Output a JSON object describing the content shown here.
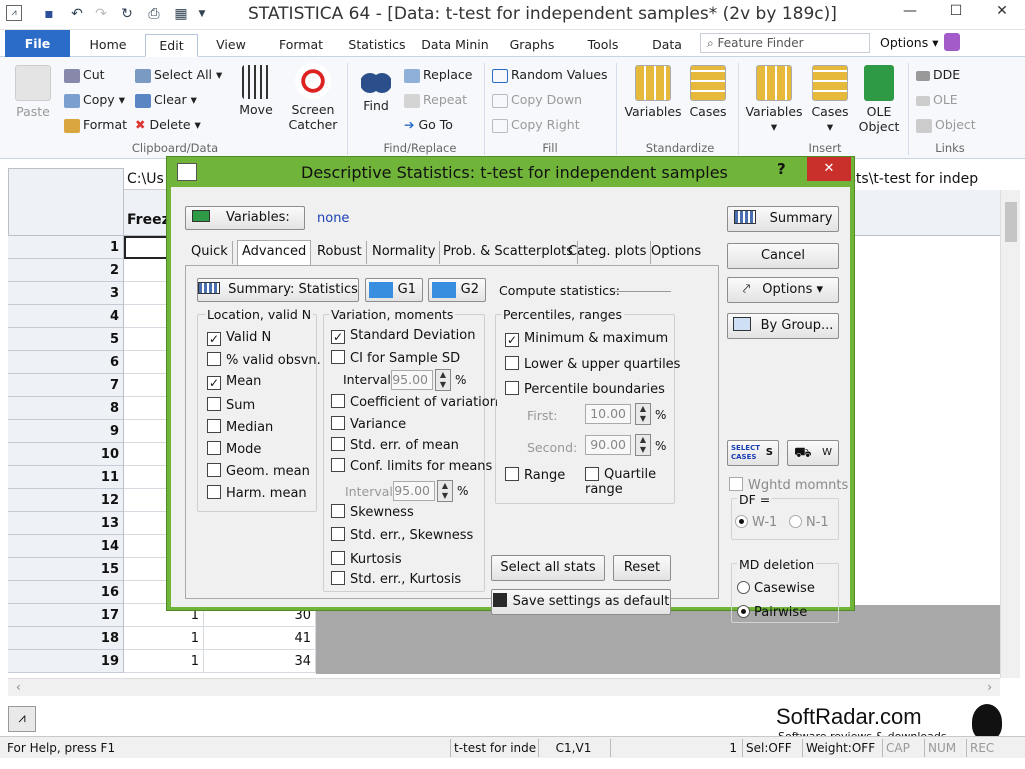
{
  "window": {
    "title": "STATISTICA 64 - [Data: t-test for independent samples* (2v by 189c)]"
  },
  "ribbon_tabs": [
    "File",
    "Home",
    "Edit",
    "View",
    "Format",
    "Statistics",
    "Data Minin",
    "Graphs",
    "Tools",
    "Data"
  ],
  "feature_finder": "Feature Finder",
  "options_menu": "Options",
  "ribbon": {
    "clipboard": {
      "paste": "Paste",
      "cut": "Cut",
      "copy": "Copy",
      "format": "Format",
      "select_all": "Select All",
      "clear": "Clear",
      "delete": "Delete",
      "move": "Move",
      "screen_catcher": "Screen Catcher",
      "group": "Clipboard/Data"
    },
    "find": {
      "find": "Find",
      "replace": "Replace",
      "repeat": "Repeat",
      "goto": "Go To",
      "group": "Find/Replace"
    },
    "fill": {
      "random": "Random Values",
      "copy_down": "Copy Down",
      "copy_right": "Copy Right",
      "group": "Fill"
    },
    "standardize": {
      "variables": "Variables",
      "cases": "Cases",
      "group": "Standardize"
    },
    "insert": {
      "variables": "Variables",
      "cases": "Cases",
      "ole": "OLE Object",
      "group": "Insert"
    },
    "links": {
      "dde": "DDE",
      "ole": "OLE",
      "object": "Object",
      "group": "Links"
    }
  },
  "sheet": {
    "path_cell": "C:\\Us",
    "path_right": "ests\\t-test for indep",
    "col_header": "Freez",
    "rows": [
      "1",
      "2",
      "3",
      "4",
      "5",
      "6",
      "7",
      "8",
      "9",
      "10",
      "11",
      "12",
      "13",
      "14",
      "15",
      "16",
      "17",
      "18",
      "19"
    ],
    "visible_values": [
      {
        "row": "17",
        "a": "1",
        "b": "30"
      },
      {
        "row": "18",
        "a": "1",
        "b": "41"
      },
      {
        "row": "19",
        "a": "1",
        "b": "34"
      }
    ]
  },
  "dialog": {
    "title": "Descriptive Statistics: t-test for independent samples",
    "help": "?",
    "close": "✕",
    "variables_btn": "Variables:",
    "variables_val": "none",
    "tabs": [
      "Quick",
      "Advanced",
      "Robust",
      "Normality",
      "Prob. & Scatterplots",
      "Categ. plots",
      "Options"
    ],
    "summary_stats_btn": "Summary: Statistics",
    "g1": "G1",
    "g2": "G2",
    "compute_label": "Compute statistics:",
    "location": {
      "title": "Location, valid N",
      "items": [
        {
          "label": "Valid N",
          "checked": true
        },
        {
          "label": "% valid obsvn.",
          "checked": false
        },
        {
          "label": "Mean",
          "checked": true
        },
        {
          "label": "Sum",
          "checked": false
        },
        {
          "label": "Median",
          "checked": false
        },
        {
          "label": "Mode",
          "checked": false
        },
        {
          "label": "Geom. mean",
          "checked": false
        },
        {
          "label": "Harm. mean",
          "checked": false
        }
      ]
    },
    "variation": {
      "title": "Variation, moments",
      "items": [
        {
          "label": "Standard Deviation",
          "checked": true
        },
        {
          "label": "CI for Sample SD",
          "checked": false
        },
        {
          "label": "Coefficient of variation",
          "checked": false
        },
        {
          "label": "Variance",
          "checked": false
        },
        {
          "label": "Std. err. of mean",
          "checked": false
        },
        {
          "label": "Conf. limits for means",
          "checked": false
        },
        {
          "label": "Skewness",
          "checked": false
        },
        {
          "label": "Std. err., Skewness",
          "checked": false
        },
        {
          "label": "Kurtosis",
          "checked": false
        },
        {
          "label": "Std. err., Kurtosis",
          "checked": false
        }
      ],
      "interval_label": "Interval:",
      "interval1": "95.00",
      "interval2": "95.00",
      "pct": "%"
    },
    "percentiles": {
      "title": "Percentiles, ranges",
      "minmax": "Minimum & maximum",
      "quartiles": "Lower & upper quartiles",
      "boundaries": "Percentile boundaries",
      "first_label": "First:",
      "first_val": "10.00",
      "second_label": "Second:",
      "second_val": "90.00",
      "range": "Range",
      "quartile_range": "Quartile range",
      "pct": "%"
    },
    "select_all": "Select all stats",
    "reset": "Reset",
    "save_default": "Save settings as default",
    "right": {
      "summary": "Summary",
      "cancel": "Cancel",
      "options": "Options",
      "bygroup": "By Group...",
      "select_cases": "SELECT CASES",
      "s": "S",
      "w": "W",
      "wghtd": "Wghtd momnts",
      "df": "DF =",
      "w1": "W-1",
      "n1": "N-1",
      "md": "MD deletion",
      "casewise": "Casewise",
      "pairwise": "Pairwise"
    }
  },
  "status": {
    "help": "For Help, press F1",
    "doc": "t-test for indep",
    "pos": "C1,V1",
    "num": "1",
    "sel": "Sel:OFF",
    "weight": "Weight:OFF",
    "cap": "CAP",
    "numl": "NUM",
    "rec": "REC"
  },
  "watermark": {
    "brand": "SoftRadar.com",
    "tag": "Software reviews & downloads"
  }
}
